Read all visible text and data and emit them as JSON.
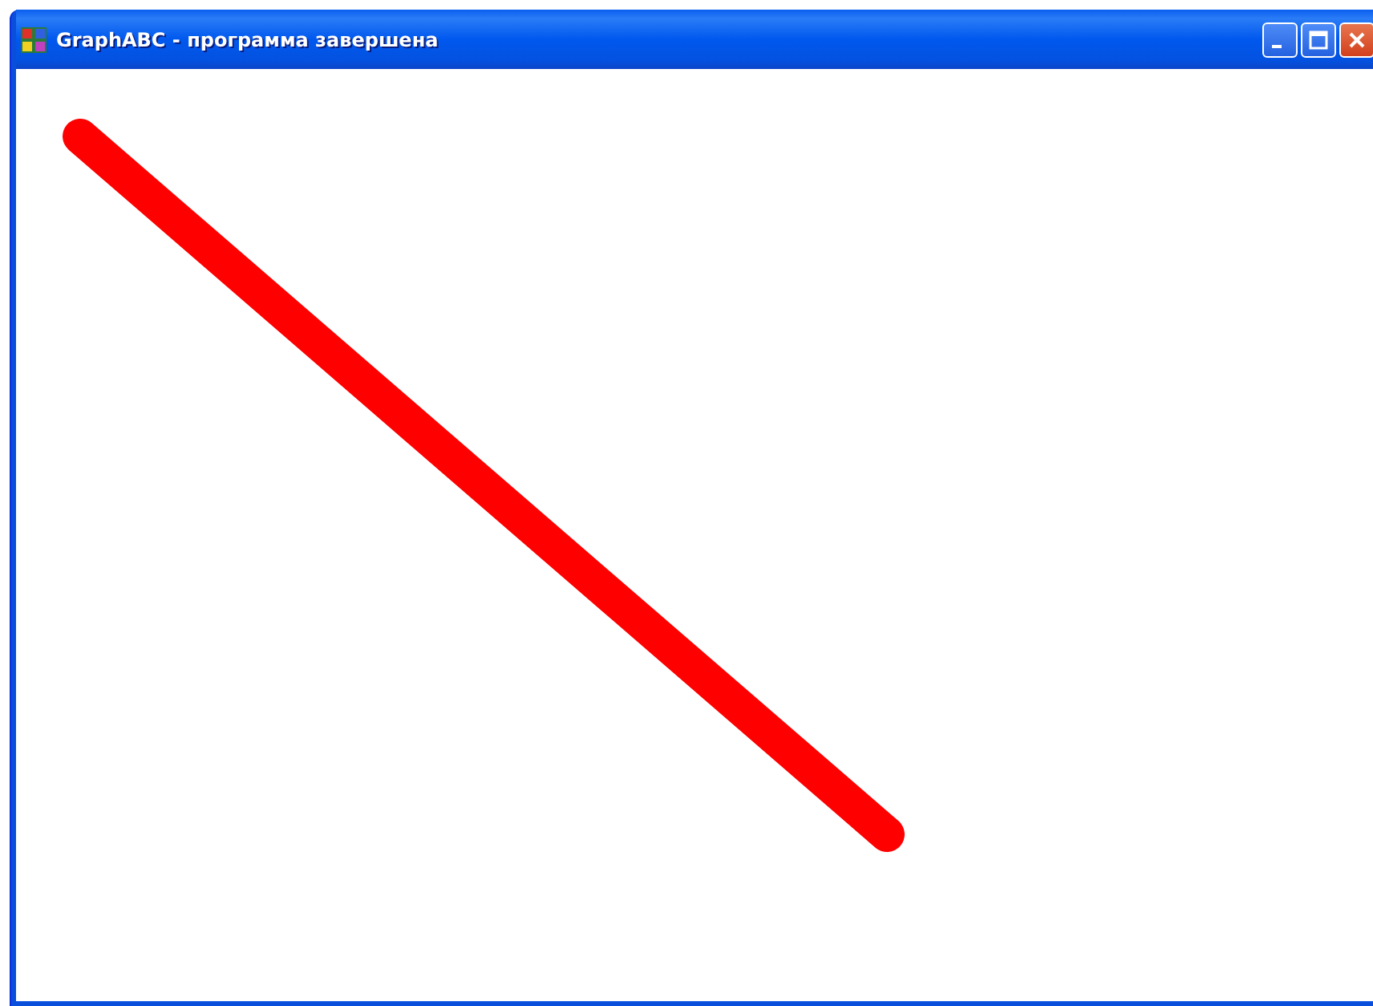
{
  "window": {
    "title": "GraphABC - программа завершена"
  }
}
